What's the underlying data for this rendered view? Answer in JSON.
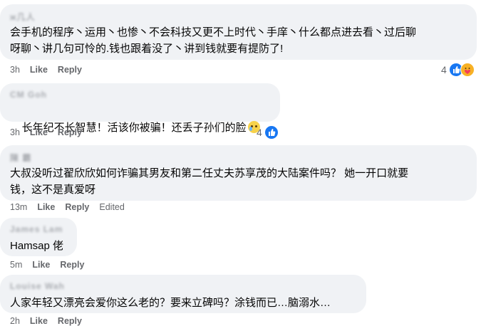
{
  "comments": [
    {
      "author": "ж几人",
      "text": "会手机的程序丶运用丶也惨丶不会科技又更不上时代丶手庠丶什么都点进去看丶过后聊\n呀聊丶讲几句可怜的.钱也跟着没了丶讲到钱就要有提防了!",
      "time": "3h",
      "like_label": "Like",
      "reply_label": "Reply",
      "edited_label": "",
      "reaction_count": "4",
      "reaction_icons": [
        "like-icon",
        "care-icon"
      ]
    },
    {
      "author": "CM Goh",
      "text": "长年纪不长智慧！活该你被骗！还丢子孙们的脸",
      "time": "3h",
      "like_label": "Like",
      "reply_label": "Reply",
      "edited_label": "",
      "reaction_count": "4",
      "reaction_icons": [
        "like-icon"
      ]
    },
    {
      "author": "陳 霸",
      "text": "大叔没听过翟欣欣如何诈骗其男友和第二任丈夫苏享茂的大陆案件吗？ 她一开口就要\n钱，这不是真爱呀",
      "time": "13m",
      "like_label": "Like",
      "reply_label": "Reply",
      "edited_label": "Edited",
      "reaction_count": "",
      "reaction_icons": []
    },
    {
      "author": "James Lam",
      "text": "Hamsap 佬",
      "time": "5m",
      "like_label": "Like",
      "reply_label": "Reply",
      "edited_label": "",
      "reaction_count": "",
      "reaction_icons": []
    },
    {
      "author": "Louise Wah",
      "text": "人家年轻又漂亮会爱你这么老的？要来立碑吗？涂钱而已…脑溺水…",
      "time": "2h",
      "like_label": "Like",
      "reply_label": "Reply",
      "edited_label": "",
      "reaction_count": "",
      "reaction_icons": []
    }
  ],
  "colors": {
    "bubble_bg": "#f0f2f5",
    "meta_text": "#65676b",
    "like_blue": "#1877f2",
    "care_yellow": "#f7b125"
  }
}
